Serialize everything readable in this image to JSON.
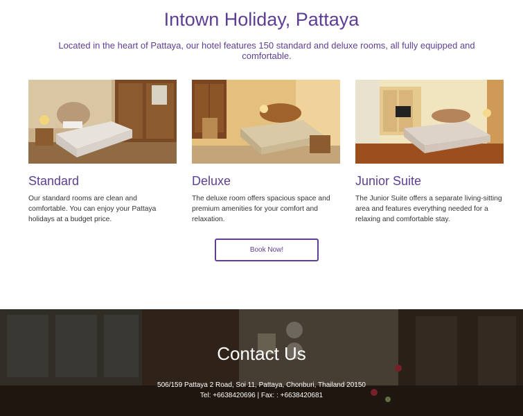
{
  "hero": {
    "title": "Intown Holiday, Pattaya",
    "description": "Located in the heart of Pattaya, our hotel features 150 standard and deluxe rooms, all fully equipped and comfortable."
  },
  "rooms": [
    {
      "title": "Standard",
      "description": "Our standard rooms are clean and comfortable. You can enjoy your Pattaya holidays at a budget price."
    },
    {
      "title": "Deluxe",
      "description": "The deluxe room offers spacious space and premium amenities for your comfort and relaxation."
    },
    {
      "title": "Junior Suite",
      "description": "The Junior Suite offers a separate living-sitting area and features everything needed for a relaxing and comfortable stay."
    }
  ],
  "book_button": {
    "label": "Book Now!"
  },
  "contact": {
    "title": "Contact Us",
    "address": "506/159 Pattaya 2 Road, Soi 11, Pattaya, Chonburi, Thailand 20150",
    "phone_fax": "Tel: +6638420696 | Fax: : +6638420681"
  },
  "colors": {
    "accent": "#5e3e94",
    "body_text": "#333333",
    "footer_overlay": "#1e1612"
  }
}
